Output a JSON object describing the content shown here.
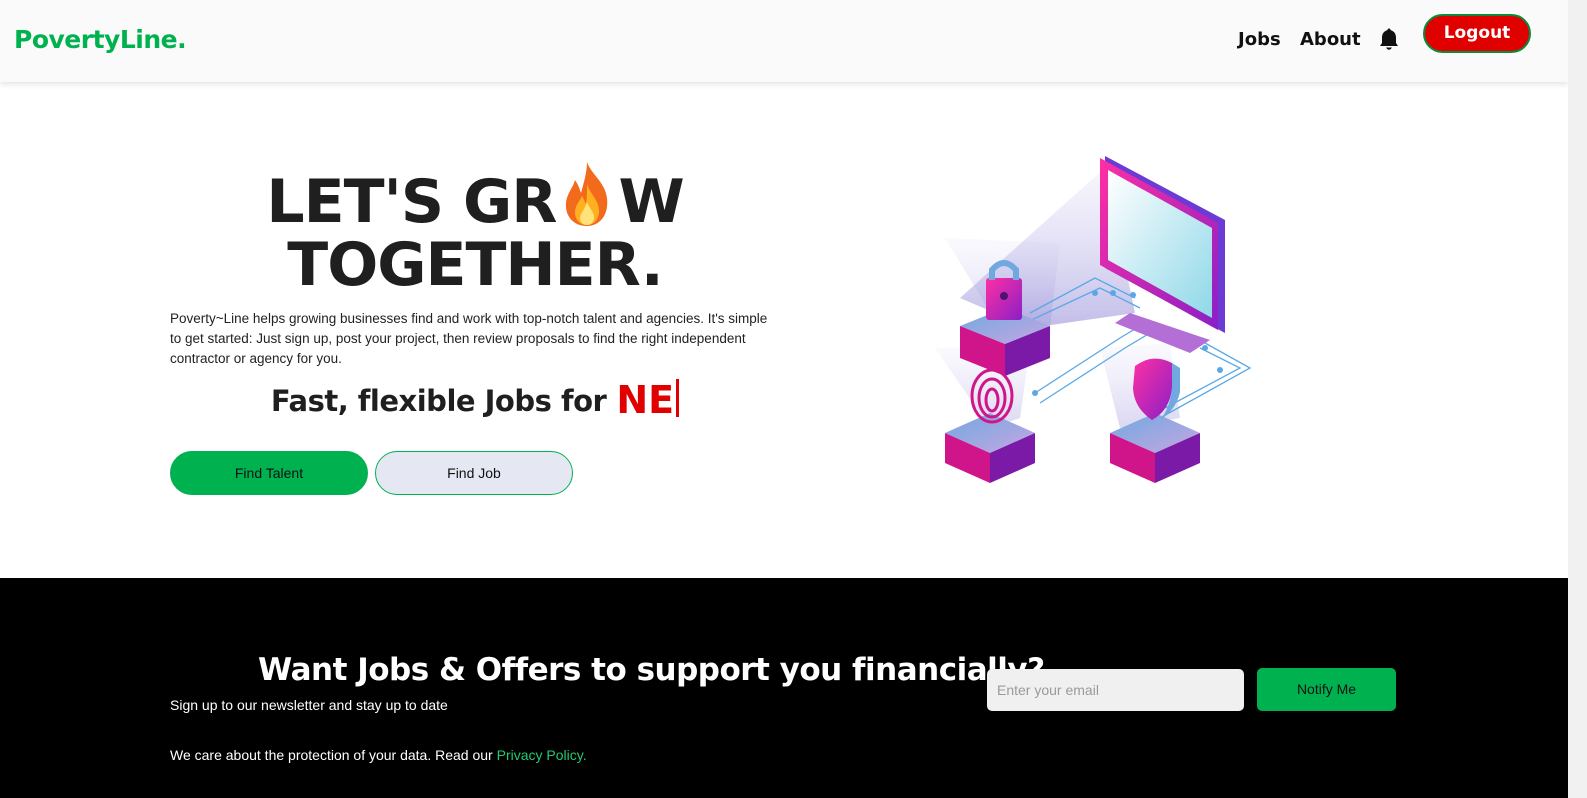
{
  "nav": {
    "logo": "PovertyLine.",
    "jobs": "Jobs",
    "about": "About",
    "bell_icon": "bell-icon",
    "logout": "Logout"
  },
  "hero": {
    "title_part1": "LET'S GR",
    "title_emoji_icon": "fire-icon",
    "title_part2": "W",
    "title_line2": "TOGETHER.",
    "description": "Poverty~Line helps growing businesses find and work with top-notch talent and agencies. It's simple to get started: Just sign up, post your project, then review proposals to find the right independent contractor or agency for you.",
    "tagline": "Fast, flexible Jobs for",
    "typed_text": "NE",
    "find_talent": "Find Talent",
    "find_job": "Find Job",
    "illustration_icon": "isometric-security-illustration"
  },
  "newsletter": {
    "title": "Want Jobs & Offers to support you financially?",
    "subtitle": "Sign up to our newsletter and stay up to date",
    "privacy_text": "We care about the protection of your data. Read our",
    "privacy_link": "Privacy Policy.",
    "email_placeholder": "Enter your email",
    "notify_button": "Notify Me"
  },
  "colors": {
    "brand_green": "#00b14f",
    "accent_red": "#e00000",
    "footer_bg": "#000000"
  }
}
